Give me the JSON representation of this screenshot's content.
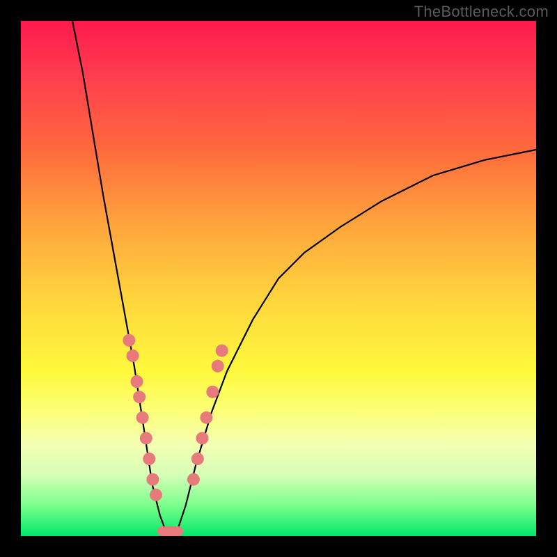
{
  "watermark": "TheBottleneck.com",
  "colors": {
    "frame": "#000000",
    "gradient_top": "#ff1a4d",
    "gradient_bottom": "#00e86b",
    "curve": "#000000",
    "marker": "#e77a7a"
  },
  "chart_data": {
    "type": "line",
    "title": "",
    "xlabel": "",
    "ylabel": "",
    "xlim": [
      0,
      100
    ],
    "ylim": [
      0,
      100
    ],
    "grid": false,
    "legend": false,
    "series": [
      {
        "name": "left-curve",
        "x": [
          10,
          12,
          14,
          16,
          18,
          20,
          22,
          24,
          25.5,
          27,
          28.5
        ],
        "y": [
          100,
          90,
          78,
          66,
          55,
          44,
          33,
          20,
          10,
          4,
          0
        ]
      },
      {
        "name": "right-curve",
        "x": [
          30,
          32,
          34,
          37,
          40,
          45,
          50,
          55,
          62,
          70,
          80,
          90,
          100
        ],
        "y": [
          0,
          6,
          14,
          24,
          32,
          42,
          50,
          55,
          60,
          65,
          70,
          73,
          75
        ]
      }
    ],
    "markers_left": [
      {
        "x": 21.0,
        "y": 38
      },
      {
        "x": 21.7,
        "y": 35
      },
      {
        "x": 22.5,
        "y": 30
      },
      {
        "x": 23.0,
        "y": 27
      },
      {
        "x": 23.6,
        "y": 23
      },
      {
        "x": 24.3,
        "y": 19
      },
      {
        "x": 24.9,
        "y": 15
      },
      {
        "x": 25.6,
        "y": 11
      },
      {
        "x": 26.2,
        "y": 8
      }
    ],
    "markers_right": [
      {
        "x": 33.5,
        "y": 11
      },
      {
        "x": 34.3,
        "y": 15
      },
      {
        "x": 35.2,
        "y": 19
      },
      {
        "x": 36.0,
        "y": 23
      },
      {
        "x": 37.2,
        "y": 28
      },
      {
        "x": 38.2,
        "y": 33
      },
      {
        "x": 39.0,
        "y": 36
      }
    ],
    "valley_blob": {
      "x_from": 26.5,
      "x_to": 31.5,
      "y": 0
    }
  }
}
